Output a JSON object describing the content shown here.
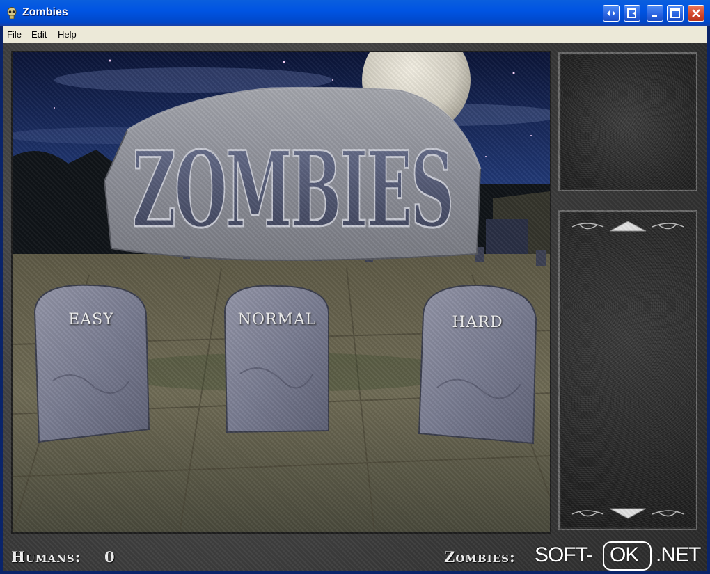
{
  "window": {
    "title": "Zombies",
    "controls": [
      "swap-icon",
      "exit-icon",
      "minimize-icon",
      "maximize-icon",
      "close-icon"
    ]
  },
  "menu": {
    "file": "File",
    "edit": "Edit",
    "help": "Help"
  },
  "game": {
    "logo_text": "ZOMBIES",
    "difficulty": {
      "easy": "EASY",
      "normal": "NORMAL",
      "hard": "HARD"
    },
    "humans_label": "Humans:",
    "humans_count": "0",
    "zombies_label": "Zombies:"
  },
  "side_panel": {
    "scroll_up": "triangle-up-icon",
    "scroll_down": "triangle-down-icon"
  },
  "watermark": {
    "part1": "SOFT-",
    "part2": "OK",
    "part3": ".NET"
  },
  "colors": {
    "titlebar": "#0054e3",
    "menubar": "#ece9d8",
    "sky": "#14204a",
    "moon": "#d8d4c8",
    "stone": "#7e8194",
    "ground": "#6f6b55"
  }
}
